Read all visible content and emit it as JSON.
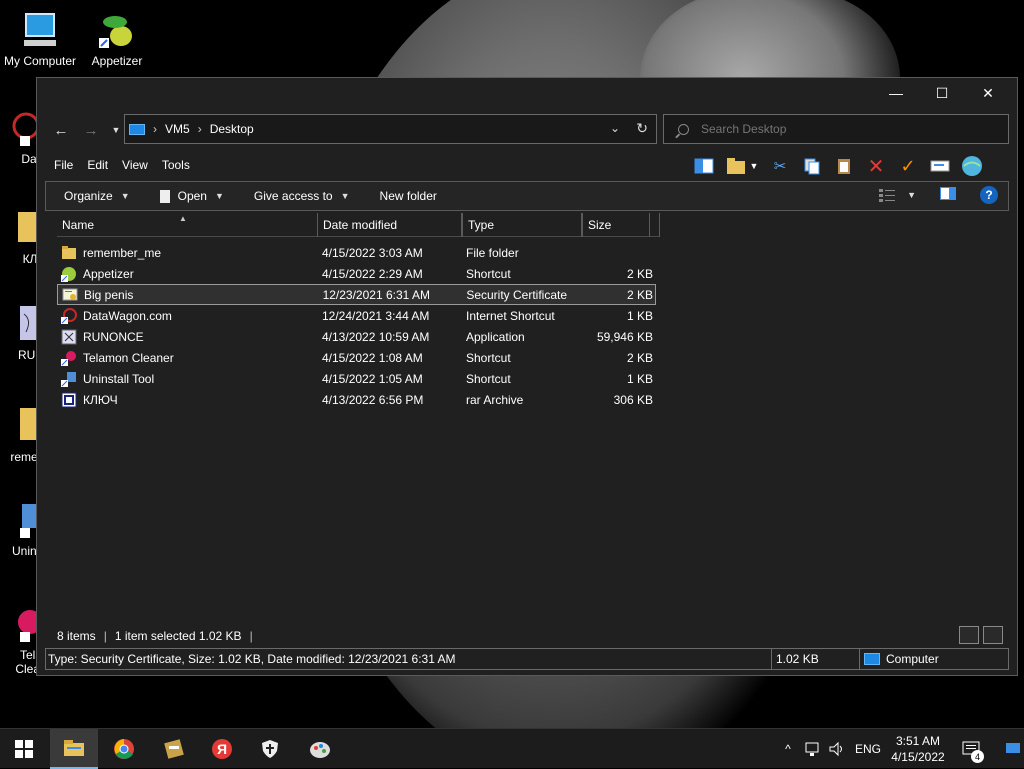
{
  "desktop": {
    "icons": [
      {
        "label": "My Computer"
      },
      {
        "label": "Appetizer"
      },
      {
        "label": "DataW"
      },
      {
        "label": "КЛ"
      },
      {
        "label": "RUN"
      },
      {
        "label": "remem"
      },
      {
        "label": "Uninst"
      },
      {
        "label": "Tela\nClean"
      }
    ]
  },
  "window": {
    "controls": {
      "minimize": "—",
      "maximize": "☐",
      "close": "✕"
    },
    "address": {
      "crumbs": [
        "VM5",
        "Desktop"
      ]
    },
    "search": {
      "placeholder": "Search Desktop"
    },
    "menu": [
      "File",
      "Edit",
      "View",
      "Tools"
    ],
    "commands": {
      "organize": "Organize",
      "open": "Open",
      "give_access": "Give access to",
      "new_folder": "New folder"
    },
    "columns": [
      "Name",
      "Date modified",
      "Type",
      "Size"
    ],
    "files": [
      {
        "name": "remember_me",
        "date": "4/15/2022 3:03 AM",
        "type": "File folder",
        "size": "",
        "icon": "folder-icon"
      },
      {
        "name": "Appetizer",
        "date": "4/15/2022 2:29 AM",
        "type": "Shortcut",
        "size": "2 KB",
        "icon": "appetizer-icon"
      },
      {
        "name": "Big penis",
        "date": "12/23/2021 6:31 AM",
        "type": "Security Certificate",
        "size": "2 KB",
        "icon": "certificate-icon",
        "selected": true
      },
      {
        "name": "DataWagon.com",
        "date": "12/24/2021 3:44 AM",
        "type": "Internet Shortcut",
        "size": "1 KB",
        "icon": "internet-shortcut-icon"
      },
      {
        "name": "RUNONCE",
        "date": "4/13/2022 10:59 AM",
        "type": "Application",
        "size": "59,946 KB",
        "icon": "application-icon"
      },
      {
        "name": "Telamon Cleaner",
        "date": "4/15/2022 1:08 AM",
        "type": "Shortcut",
        "size": "2 KB",
        "icon": "telamon-icon"
      },
      {
        "name": "Uninstall Tool",
        "date": "4/15/2022 1:05 AM",
        "type": "Shortcut",
        "size": "1 KB",
        "icon": "uninstall-icon"
      },
      {
        "name": "КЛЮЧ",
        "date": "4/13/2022 6:56 PM",
        "type": "rar Archive",
        "size": "306 KB",
        "icon": "rar-icon"
      }
    ],
    "status": {
      "items": "8 items",
      "selected": "1 item selected  1.02 KB",
      "details": "Type: Security Certificate, Size: 1.02 KB, Date modified: 12/23/2021 6:31 AM",
      "size": "1.02 KB",
      "location": "Computer"
    }
  },
  "taskbar": {
    "language": "ENG",
    "time": "3:51 AM",
    "date": "4/15/2022",
    "notifications": "4"
  },
  "colors": {
    "accent": "#1e88e5",
    "selection": "#303030",
    "window_bg": "#202020"
  }
}
